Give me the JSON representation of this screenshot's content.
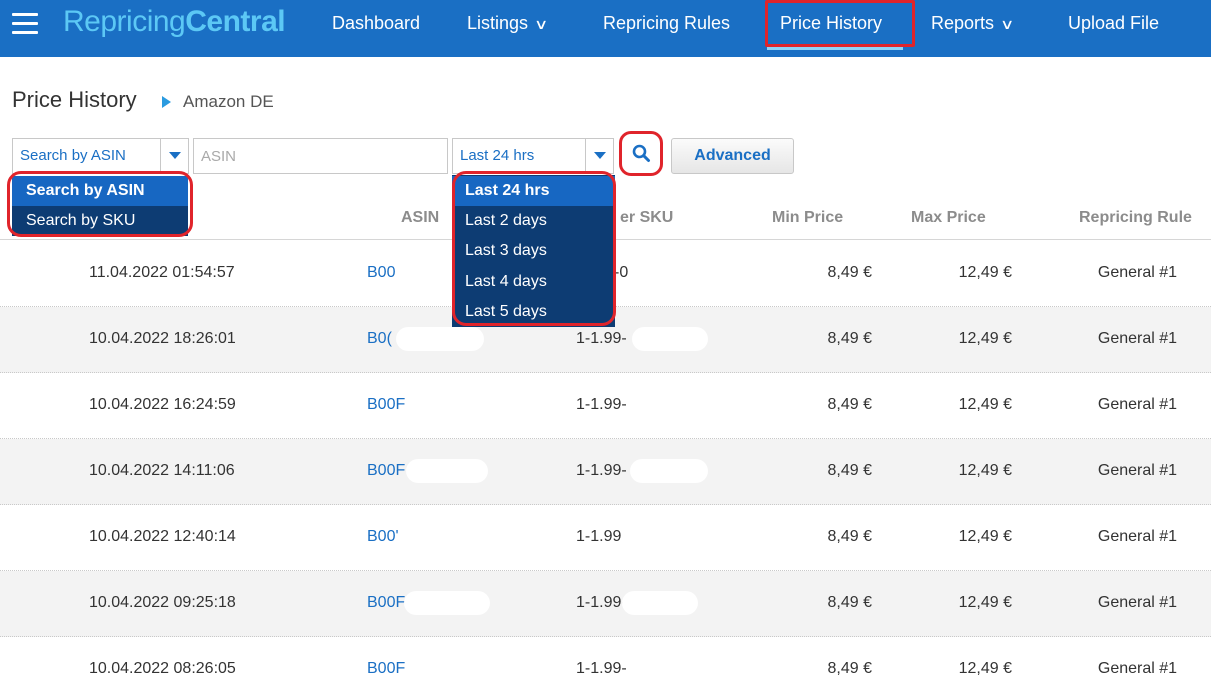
{
  "app": {
    "brand_a": "Repricing",
    "brand_b": "Central"
  },
  "nav": {
    "dashboard": "Dashboard",
    "listings": "Listings",
    "repricing_rules": "Repricing Rules",
    "price_history": "Price History",
    "reports": "Reports",
    "upload_file": "Upload File",
    "active": "Price History"
  },
  "page": {
    "title": "Price History",
    "marketplace": "Amazon DE"
  },
  "search": {
    "type_value": "Search by ASIN",
    "input_placeholder": "ASIN",
    "period_value": "Last 24 hrs",
    "advanced_label": "Advanced",
    "type_options": [
      "Search by ASIN",
      "Search by SKU"
    ],
    "period_options": [
      "Last 24 hrs",
      "Last 2 days",
      "Last 3 days",
      "Last 4 days",
      "Last 5 days"
    ]
  },
  "table": {
    "headers": {
      "asin": "ASIN",
      "seller_sku": "er SKU",
      "min_price": "Min Price",
      "max_price": "Max Price",
      "repricing_rule": "Repricing Rule"
    },
    "rows": [
      {
        "date": "11.04.2022 01:54:57",
        "asin": "B00",
        "sku": "-0",
        "min_price": "8,49 €",
        "max_price": "12,49 €",
        "rule": "General #1"
      },
      {
        "date": "10.04.2022 18:26:01",
        "asin": "B0(",
        "sku": "1-1.99-",
        "min_price": "8,49 €",
        "max_price": "12,49 €",
        "rule": "General #1"
      },
      {
        "date": "10.04.2022 16:24:59",
        "asin": "B00F",
        "sku": "1-1.99-",
        "min_price": "8,49 €",
        "max_price": "12,49 €",
        "rule": "General #1"
      },
      {
        "date": "10.04.2022 14:11:06",
        "asin": "B00F",
        "sku": "1-1.99-",
        "min_price": "8,49 €",
        "max_price": "12,49 €",
        "rule": "General #1"
      },
      {
        "date": "10.04.2022 12:40:14",
        "asin": "B00'",
        "sku": "1-1.99",
        "min_price": "8,49 €",
        "max_price": "12,49 €",
        "rule": "General #1"
      },
      {
        "date": "10.04.2022 09:25:18",
        "asin": "B00F",
        "sku": "1-1.99-",
        "min_price": "8,49 €",
        "max_price": "12,49 €",
        "rule": "General #1"
      },
      {
        "date": "10.04.2022 08:26:05",
        "asin": "B00F",
        "sku": "1-1.99-",
        "min_price": "8,49 €",
        "max_price": "12,49 €",
        "rule": "General #1"
      }
    ]
  },
  "colors": {
    "topbar": "#1a6fc4",
    "brand": "#5cc8f5",
    "accent_red": "#e0242b",
    "dropdown_bg": "#0d3c73",
    "dropdown_selected": "#1767c2"
  },
  "icons": {
    "menu": "hamburger-menu-icon",
    "search": "search-icon",
    "chevron": "chevron-down-icon"
  }
}
